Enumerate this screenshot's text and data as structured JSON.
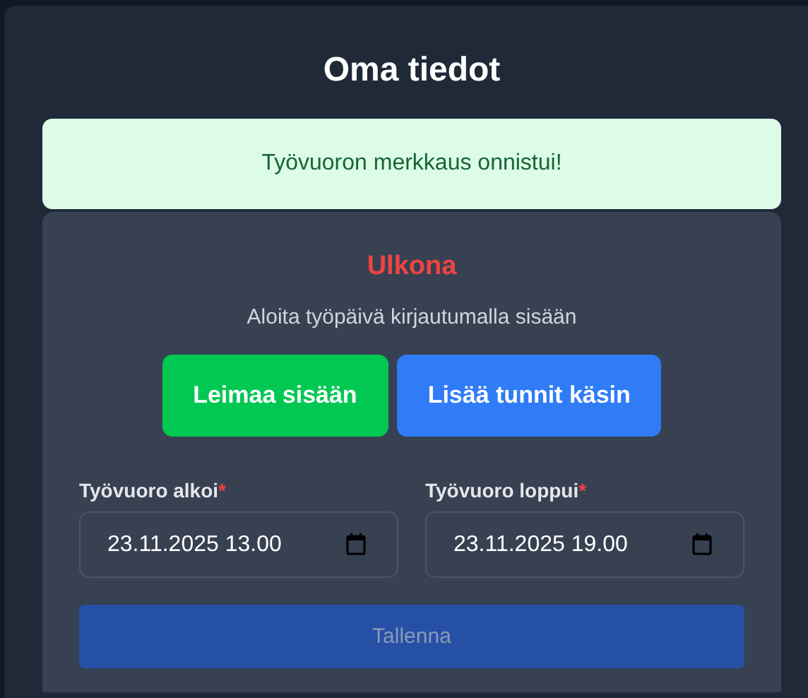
{
  "title": "Oma tiedot",
  "alert": {
    "text": "Työvuoron merkkaus onnistui!"
  },
  "status": {
    "text": "Ulkona",
    "hint": "Aloita työpäivä kirjautumalla sisään"
  },
  "actions": [
    {
      "label": "Leimaa sisään",
      "kind": "primary"
    },
    {
      "label": "Lisää tunnit käsin",
      "kind": "secondary"
    }
  ],
  "fields": [
    {
      "label": "Työvuoro alkoi",
      "required_mark": "*",
      "value": "23.11.2025 13.00"
    },
    {
      "label": "Työvuoro loppui",
      "required_mark": "*",
      "value": "23.11.2025 19.00"
    }
  ],
  "save": {
    "label": "Tallenna",
    "disabled": true
  }
}
